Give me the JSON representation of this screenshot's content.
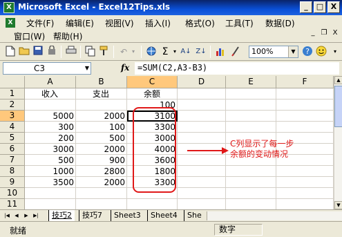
{
  "window": {
    "title": "Microsoft Excel - Excel12Tips.xls",
    "minimize": "_",
    "maximize": "□",
    "close": "X"
  },
  "menubar": {
    "items": [
      "文件(F)",
      "编辑(E)",
      "视图(V)",
      "插入(I)",
      "格式(O)",
      "工具(T)",
      "数据(D)",
      "窗口(W)",
      "帮助(H)"
    ],
    "minimize": "_",
    "restore": "❐",
    "close": "X"
  },
  "toolbar": {
    "zoom": "100%",
    "sum_glyph": "Σ"
  },
  "formula_bar": {
    "name_box": "C3",
    "fx": "fx",
    "formula": "=SUM(C2,A3-B3)"
  },
  "sheet": {
    "columns": [
      "A",
      "B",
      "C",
      "D",
      "E",
      "F"
    ],
    "rows": [
      "1",
      "2",
      "3",
      "4",
      "5",
      "6",
      "7",
      "8",
      "9",
      "10",
      "11"
    ],
    "headers": {
      "A": "收入",
      "B": "支出",
      "C": "余额"
    },
    "cells": {
      "C2": "100",
      "A3": "5000",
      "B3": "2000",
      "C3": "3100",
      "A4": "300",
      "B4": "100",
      "C4": "3300",
      "A5": "200",
      "B5": "500",
      "C5": "3000",
      "A6": "3000",
      "B6": "2000",
      "C6": "4000",
      "A7": "500",
      "B7": "900",
      "C7": "3600",
      "A8": "1000",
      "B8": "2800",
      "C8": "1800",
      "A9": "3500",
      "B9": "2000",
      "C9": "3300"
    },
    "active_cell": "C3"
  },
  "annotation": {
    "line1": "C列显示了每一步",
    "line2": "余额的变动情况",
    "color": "#e01818"
  },
  "tabs": [
    "技巧2",
    "技巧7",
    "Sheet3",
    "Sheet4",
    "She"
  ],
  "status": {
    "left": "就绪",
    "right": "数字"
  }
}
